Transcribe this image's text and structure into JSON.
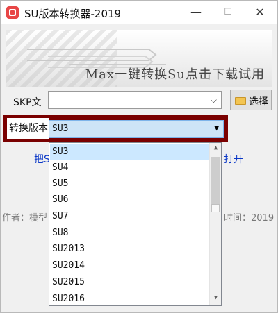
{
  "window": {
    "title": "SU版本转换器-2019"
  },
  "titlebar": {
    "minimize": "—",
    "maximize": "☐",
    "close": "✕"
  },
  "banner": {
    "text": "Max一键转换Su点击下载试用"
  },
  "file": {
    "label": "SKP文",
    "value": "",
    "choose_label": "选择"
  },
  "version": {
    "label": "转换版本",
    "selected": "SU3"
  },
  "links": {
    "left": "把S",
    "right": "打开"
  },
  "footer": {
    "left": "作者：模型",
    "right": "时间：2019"
  },
  "dropdown": {
    "items": [
      "SU3",
      "SU4",
      "SU5",
      "SU6",
      "SU7",
      "SU8",
      "SU2013",
      "SU2014",
      "SU2015",
      "SU2016"
    ],
    "selected_index": 0
  },
  "colors": {
    "frame": "#7a0000",
    "link": "#0b38c7",
    "highlight": "#cce8ff",
    "app_icon": "#e84646"
  }
}
